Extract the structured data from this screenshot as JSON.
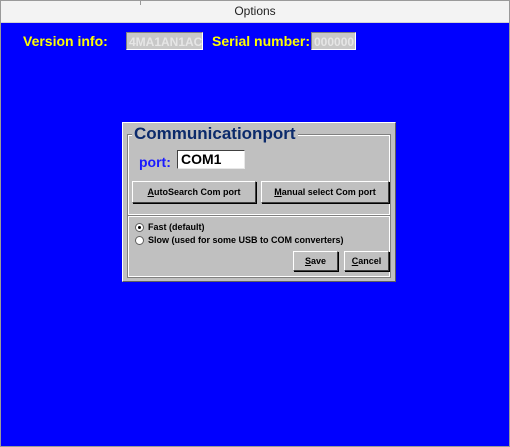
{
  "window": {
    "title": "Options"
  },
  "header": {
    "version_label": "Version info:",
    "version_value": "4MA1AN1AC",
    "serial_label": "Serial number:",
    "serial_value": "000000"
  },
  "dialog": {
    "group_title": "Communicationport",
    "port_label": "port:",
    "port_value": "COM1",
    "autosearch_button": "AutoSearch Com port",
    "manual_button": "Manual select Com port",
    "options": [
      {
        "label": "Fast (default)",
        "selected": true
      },
      {
        "label": "Slow (used for some USB to COM converters)",
        "selected": false
      }
    ],
    "save_button": "Save",
    "cancel_button": "Cancel"
  },
  "colors": {
    "background": "#0000ff",
    "info_text": "#ffff00",
    "dialog": "#c0c0c0",
    "group_title": "#0b2a6b",
    "port_label": "#1a1aff"
  }
}
